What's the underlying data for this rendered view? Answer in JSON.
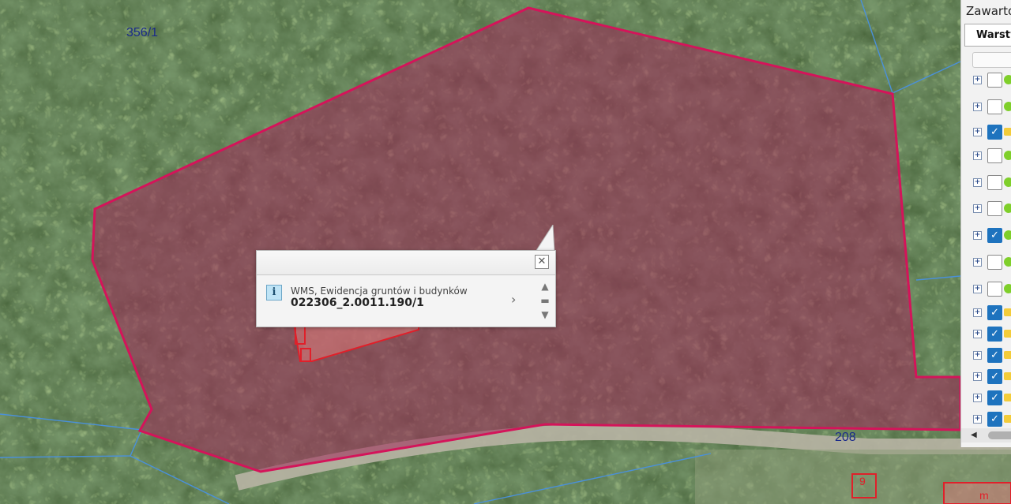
{
  "map": {
    "parcel_labels": [
      "356/1",
      "208",
      "9",
      "m"
    ]
  },
  "popup": {
    "close_label": "✕",
    "info_icon_label": "i",
    "layer_name": "WMS, Ewidencja gruntów i budynków",
    "feature_id": "022306_2.0011.190/1",
    "next_label": "›",
    "scroll_up": "▲",
    "scroll_mid": "▬",
    "scroll_down": "▼"
  },
  "panel": {
    "title": "Zawartość",
    "tab_label": "Warstwy",
    "layers": [
      {
        "checked": false,
        "indicator": "green"
      },
      {
        "checked": false,
        "indicator": "green"
      },
      {
        "checked": true,
        "indicator": "folder"
      },
      {
        "checked": false,
        "indicator": "green"
      },
      {
        "checked": false,
        "indicator": "green"
      },
      {
        "checked": false,
        "indicator": "green"
      },
      {
        "checked": true,
        "indicator": "green"
      },
      {
        "checked": false,
        "indicator": "green"
      },
      {
        "checked": false,
        "indicator": "green"
      },
      {
        "checked": true,
        "indicator": "folder"
      },
      {
        "checked": true,
        "indicator": "folder"
      },
      {
        "checked": true,
        "indicator": "folder"
      },
      {
        "checked": true,
        "indicator": "folder"
      },
      {
        "checked": true,
        "indicator": "folder"
      },
      {
        "checked": true,
        "indicator": "folder"
      }
    ]
  },
  "colors": {
    "parcel_outline": "#d4145a",
    "parcel_fill": "#a0285a",
    "boundary_lines": "#4a90d9",
    "accent": "#1e73be"
  }
}
